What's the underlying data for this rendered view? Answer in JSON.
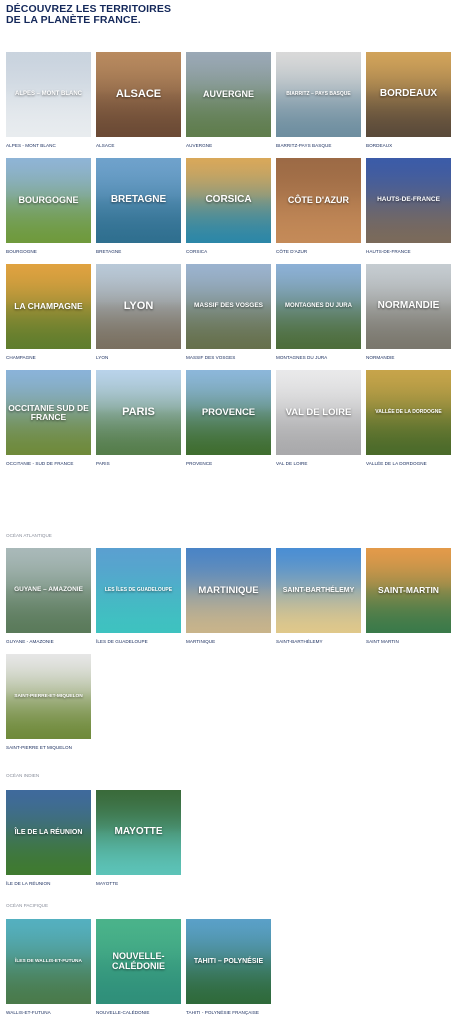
{
  "title": {
    "line1": "Découvrez les territoires",
    "line2": "de la planète France."
  },
  "mainland": [
    {
      "overlay": "Alpes – Mont Blanc",
      "caption": "Alpes - Mont Blanc",
      "sky": "#c9d3de",
      "land": "#e8ecef",
      "size": "6px"
    },
    {
      "overlay": "Alsace",
      "caption": "Alsace",
      "sky": "#b88a5f",
      "land": "#6b4a35",
      "size": "11px"
    },
    {
      "overlay": "Auvergne",
      "caption": "Auvergne",
      "sky": "#9aa8b6",
      "land": "#5f7d4d",
      "size": "9px"
    },
    {
      "overlay": "Biarritz – Pays Basque",
      "caption": "Biarritz-Pays Basque",
      "sky": "#d9d9d9",
      "land": "#6e8ea0",
      "size": "5px"
    },
    {
      "overlay": "Bordeaux",
      "caption": "Bordeaux",
      "sky": "#d1a35a",
      "land": "#5a4a3a",
      "size": "10px"
    },
    {
      "overlay": "Bourgogne",
      "caption": "Bourgogne",
      "sky": "#8fb4d6",
      "land": "#6f9a3c",
      "size": "9px"
    },
    {
      "overlay": "Bretagne",
      "caption": "Bretagne",
      "sky": "#6fa2cc",
      "land": "#2f6f8f",
      "size": "10px"
    },
    {
      "overlay": "Corsica",
      "caption": "Corsica",
      "sky": "#d9a85a",
      "land": "#2c87a8",
      "size": "10px"
    },
    {
      "overlay": "Côte d'Azur",
      "caption": "Côte d'Azur",
      "sky": "#9c6a45",
      "land": "#c48a58",
      "size": "9px"
    },
    {
      "overlay": "Hauts-de-France",
      "caption": "Hauts-de-France",
      "sky": "#3b5ba8",
      "land": "#7b6a5a",
      "size": "6.5px"
    },
    {
      "overlay": "La Champagne",
      "caption": "Champagne",
      "sky": "#e0a240",
      "land": "#5f7d2d",
      "size": "8.5px"
    },
    {
      "overlay": "Lyon",
      "caption": "Lyon",
      "sky": "#b9c9d8",
      "land": "#7a7060",
      "size": "11px"
    },
    {
      "overlay": "Massif des Vosges",
      "caption": "Massif des Vosges",
      "sky": "#9bb3cf",
      "land": "#66704c",
      "size": "6.5px"
    },
    {
      "overlay": "Montagnes du Jura",
      "caption": "Montagnes du Jura",
      "sky": "#8cb0d6",
      "land": "#4d6d3a",
      "size": "6px"
    },
    {
      "overlay": "Normandie",
      "caption": "Normandie",
      "sky": "#c5ccd1",
      "land": "#7a776d",
      "size": "10px"
    },
    {
      "overlay": "Occitanie Sud de France",
      "caption": "Occitanie - Sud de France",
      "sky": "#8ab3d9",
      "land": "#6f8a3a",
      "size": "8.5px"
    },
    {
      "overlay": "Paris",
      "caption": "Paris",
      "sky": "#b9d3ea",
      "land": "#557d4a",
      "size": "11px"
    },
    {
      "overlay": "Provence",
      "caption": "Provence",
      "sky": "#8cb7da",
      "land": "#3f6d2f",
      "size": "9.5px"
    },
    {
      "overlay": "Val de Loire",
      "caption": "Val de Loire",
      "sky": "#e9e9ea",
      "land": "#a9a9ab",
      "size": "9.5px"
    },
    {
      "overlay": "Vallée de la Dordogne",
      "caption": "Vallée de la Dordogne",
      "sky": "#c7a44a",
      "land": "#4a6a2a",
      "size": "5px"
    }
  ],
  "atlantic": {
    "label": "Océan Atlantique",
    "items": [
      {
        "overlay": "Guyane – Amazonie",
        "caption": "Guyane - Amazonie",
        "sky": "#a9b9b9",
        "land": "#5a7a5a",
        "size": "6.5px"
      },
      {
        "overlay": "Les Îles de Guadeloupe",
        "caption": "Îles de Guadeloupe",
        "sky": "#5aa0d0",
        "land": "#3ec2c0",
        "size": "5px"
      },
      {
        "overlay": "Martinique",
        "caption": "Martinique",
        "sky": "#4a84c6",
        "land": "#c9b48a",
        "size": "9.5px"
      },
      {
        "overlay": "Saint-Barthélemy",
        "caption": "Saint-Barthélemy",
        "sky": "#4a8ed4",
        "land": "#e0c88a",
        "size": "7px"
      },
      {
        "overlay": "Saint-Martin",
        "caption": "Saint Martin",
        "sky": "#e39a4a",
        "land": "#3a7a4a",
        "size": "8.5px"
      },
      {
        "overlay": "Saint-Pierre-et-Miquelon",
        "caption": "Saint-Pierre et Miquelon",
        "sky": "#e6e6e6",
        "land": "#6f8a3a",
        "size": "4.8px"
      }
    ]
  },
  "indian": {
    "label": "Océan Indien",
    "items": [
      {
        "overlay": "Île de La Réunion",
        "caption": "Île de La Réunion",
        "sky": "#3f6a9c",
        "land": "#3f7a2f",
        "size": "7px"
      },
      {
        "overlay": "Mayotte",
        "caption": "Mayotte",
        "sky": "#3a6a3a",
        "land": "#5cc3b8",
        "size": "10px"
      }
    ]
  },
  "pacific": {
    "label": "Océan Pacifique",
    "items": [
      {
        "overlay": "Îles de Wallis-et-Futuna",
        "caption": "Wallis-et-Futuna",
        "sky": "#54b0c0",
        "land": "#4a7a4a",
        "size": "4.8px"
      },
      {
        "overlay": "Nouvelle-Calédonie",
        "caption": "Nouvelle-Calédonie",
        "sky": "#4ab38a",
        "land": "#2f8f7a",
        "size": "9px"
      },
      {
        "overlay": "Tahiti – Polynésie",
        "caption": "Tahiti - Polynésie française",
        "sky": "#5aa0c8",
        "land": "#2f6a3a",
        "size": "7px"
      }
    ]
  }
}
